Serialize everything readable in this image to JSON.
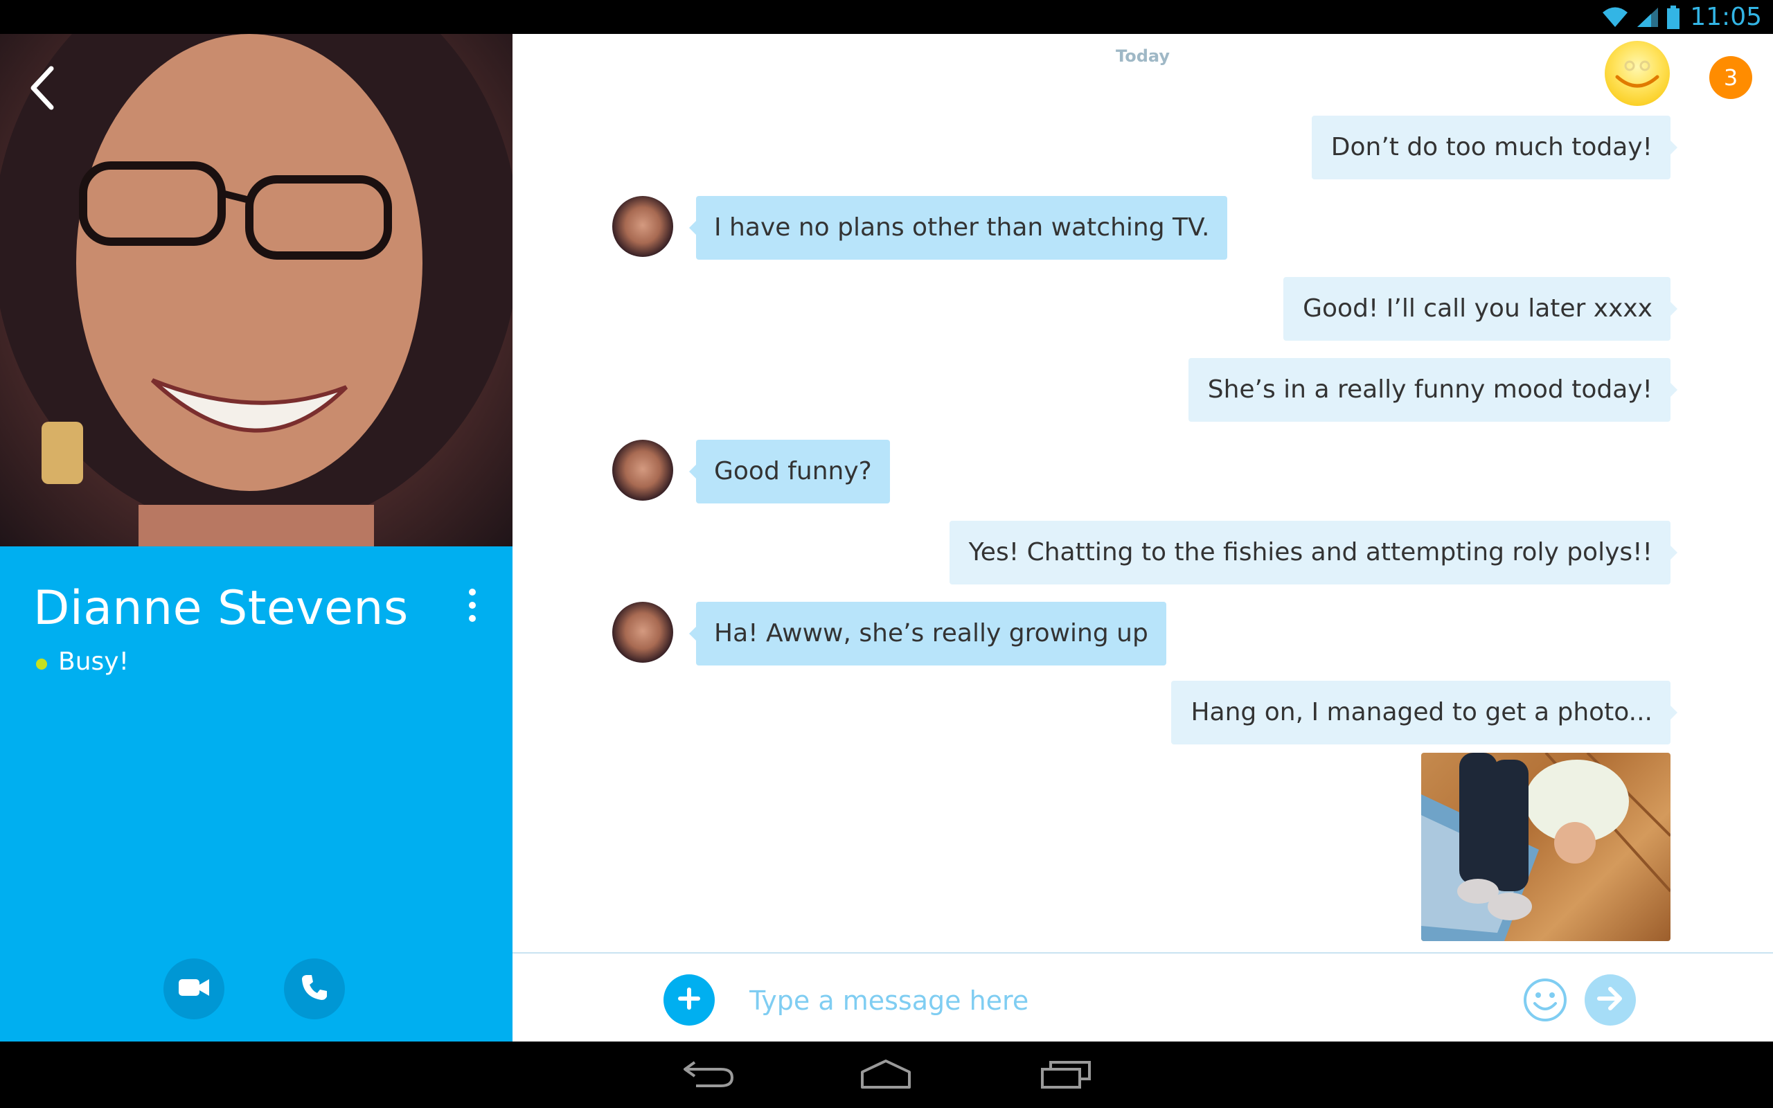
{
  "status_bar": {
    "time": "11:05"
  },
  "contact": {
    "name": "Dianne Stevens",
    "status_message": "Busy!",
    "presence_color": "#c6e01f",
    "accent_color": "#00aff0"
  },
  "chat": {
    "date_label": "Today",
    "notification_count": "3",
    "messages": [
      {
        "direction": "out",
        "text": "Don’t do too much today!"
      },
      {
        "direction": "in",
        "text": "I have no plans other than watching TV."
      },
      {
        "direction": "out",
        "text": "Good! I’ll call you later xxxx"
      },
      {
        "direction": "out",
        "text": "She’s in a really funny mood today!"
      },
      {
        "direction": "in",
        "text": "Good funny?"
      },
      {
        "direction": "out",
        "text": "Yes! Chatting to the fishies and attempting roly polys!!"
      },
      {
        "direction": "in",
        "text": "Ha! Awww, she’s really growing up"
      },
      {
        "direction": "out",
        "text": "Hang on, I managed to get a photo..."
      }
    ]
  },
  "compose": {
    "placeholder": "Type a message here",
    "add_icon": "plus-icon",
    "emoji_icon": "smiley-icon",
    "send_icon": "arrow-right-icon"
  },
  "icons": {
    "back": "chevron-left-icon",
    "menu": "more-vertical-icon",
    "video": "video-camera-icon",
    "call": "phone-icon"
  }
}
